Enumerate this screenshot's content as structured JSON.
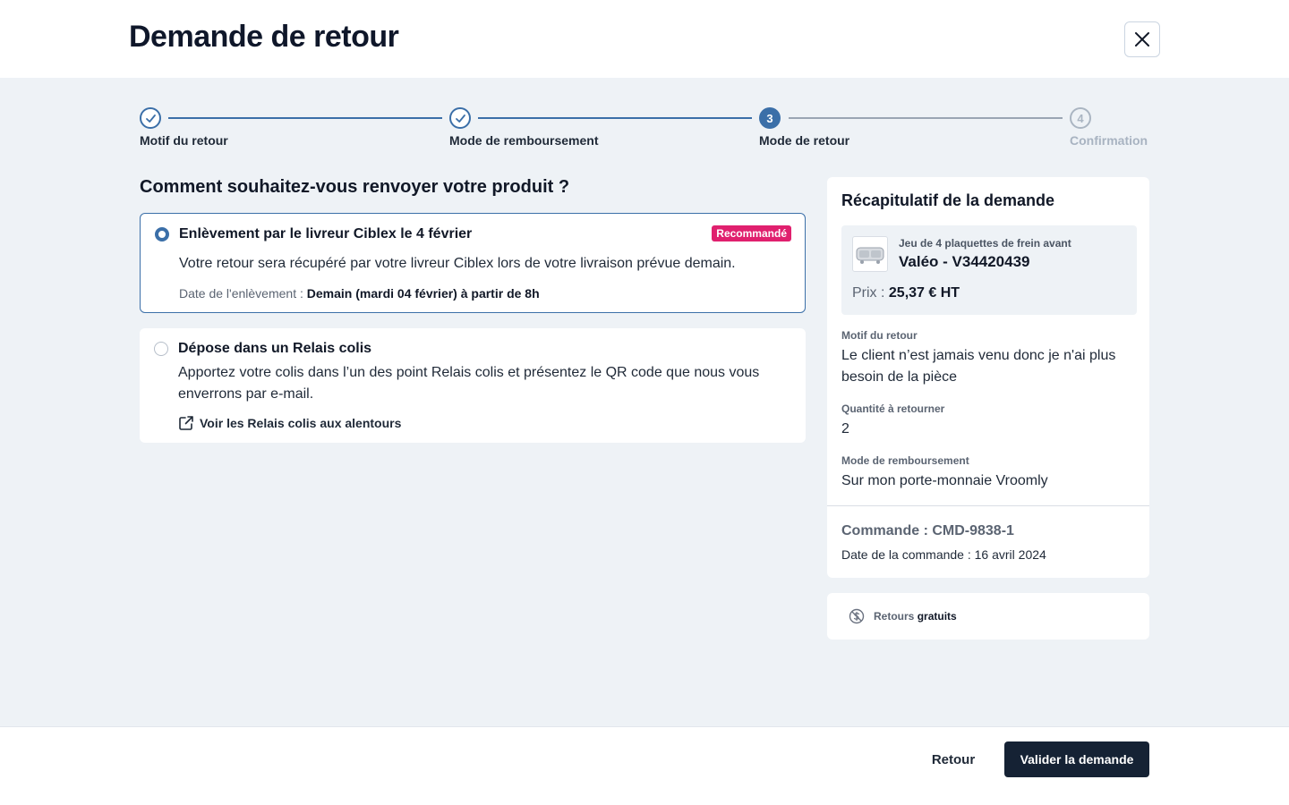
{
  "header": {
    "title": "Demande de retour",
    "close_icon": "close-icon"
  },
  "stepper": {
    "steps": [
      {
        "number": "1",
        "label": "Motif du retour",
        "status": "done"
      },
      {
        "number": "2",
        "label": "Mode de remboursement",
        "status": "done"
      },
      {
        "number": "3",
        "label": "Mode de retour",
        "status": "active"
      },
      {
        "number": "4",
        "label": "Confirmation",
        "status": "todo"
      }
    ]
  },
  "main": {
    "question": "Comment souhaitez-vous renvoyer votre produit ?",
    "options": [
      {
        "title": "Enlèvement par le livreur Ciblex le 4 février",
        "badge": "Recommandé",
        "description": "Votre retour sera récupéré par votre livreur Ciblex lors de votre livraison prévue demain.",
        "pickup_label": "Date de l'enlèvement :",
        "pickup_value": "Demain (mardi 04 février) à partir de 8h",
        "selected": true
      },
      {
        "title": "Dépose dans un Relais colis",
        "description": "Apportez votre colis dans l’un des point Relais colis et présentez le QR code que nous vous enverrons par e-mail.",
        "link_label": "Voir les Relais colis aux alentours",
        "link_icon": "external-link-icon",
        "selected": false
      }
    ]
  },
  "summary": {
    "title": "Récapitulatif de la demande",
    "product": {
      "subtitle": "Jeu de 4 plaquettes de frein avant",
      "name": "Valéo - V34420439",
      "price_label": "Prix :",
      "price_value": "25,37 € HT"
    },
    "reason_label": "Motif du retour",
    "reason_value": "Le client n’est jamais venu donc je n'ai plus besoin de la pièce",
    "quantity_label": "Quantité à retourner",
    "quantity_value": "2",
    "refund_label": "Mode de remboursement",
    "refund_value": "Sur mon porte-monnaie Vroomly",
    "order_number": "Commande : CMD-9838-1",
    "order_date": "Date de la commande : 16 avril 2024"
  },
  "free_returns": {
    "part1": "Retours",
    "part2": "gratuits"
  },
  "footer": {
    "back_label": "Retour",
    "submit_label": "Valider la demande"
  },
  "colors": {
    "primary": "#3b6fa8",
    "badge": "#e0206e",
    "submit": "#152234",
    "background": "#eef2f6"
  }
}
